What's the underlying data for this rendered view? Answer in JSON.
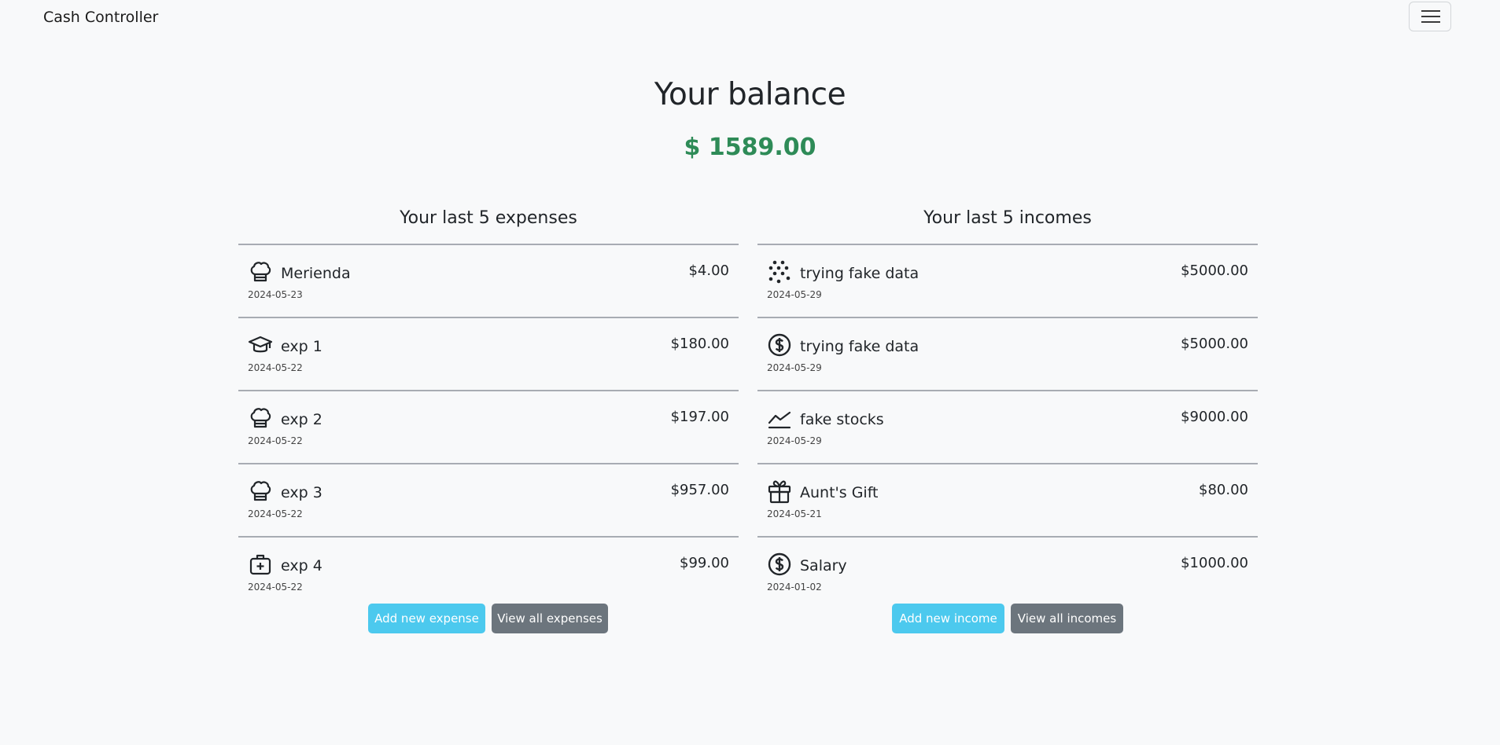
{
  "navbar": {
    "brand": "Cash Controller",
    "menu_icon": "hamburger-menu-icon"
  },
  "balance": {
    "title": "Your balance",
    "amount": "$ 1589.00",
    "amount_color": "#2e8b57"
  },
  "expenses": {
    "title": "Your last 5 expenses",
    "items": [
      {
        "icon": "chef-hat-icon",
        "name": "Merienda",
        "date": "2024-05-23",
        "amount": "$4.00"
      },
      {
        "icon": "graduation-cap-icon",
        "name": "exp 1",
        "date": "2024-05-22",
        "amount": "$180.00"
      },
      {
        "icon": "chef-hat-icon",
        "name": "exp 2",
        "date": "2024-05-22",
        "amount": "$197.00"
      },
      {
        "icon": "chef-hat-icon",
        "name": "exp 3",
        "date": "2024-05-22",
        "amount": "$957.00"
      },
      {
        "icon": "medical-kit-icon",
        "name": "exp 4",
        "date": "2024-05-22",
        "amount": "$99.00"
      }
    ],
    "add_label": "Add new expense",
    "view_label": "View all expenses"
  },
  "incomes": {
    "title": "Your last 5 incomes",
    "items": [
      {
        "icon": "dots-icon",
        "name": "trying fake data",
        "date": "2024-05-29",
        "amount": "$5000.00"
      },
      {
        "icon": "dollar-coin-icon",
        "name": "trying fake data",
        "date": "2024-05-29",
        "amount": "$5000.00"
      },
      {
        "icon": "graph-up-icon",
        "name": "fake stocks",
        "date": "2024-05-29",
        "amount": "$9000.00"
      },
      {
        "icon": "gift-icon",
        "name": "Aunt's Gift",
        "date": "2024-05-21",
        "amount": "$80.00"
      },
      {
        "icon": "dollar-coin-icon",
        "name": "Salary",
        "date": "2024-01-02",
        "amount": "$1000.00"
      }
    ],
    "add_label": "Add new income",
    "view_label": "View all incomes"
  },
  "colors": {
    "info_button": "#4cc9ee",
    "secondary_button": "#6c757d",
    "background": "#f8f9fa"
  }
}
